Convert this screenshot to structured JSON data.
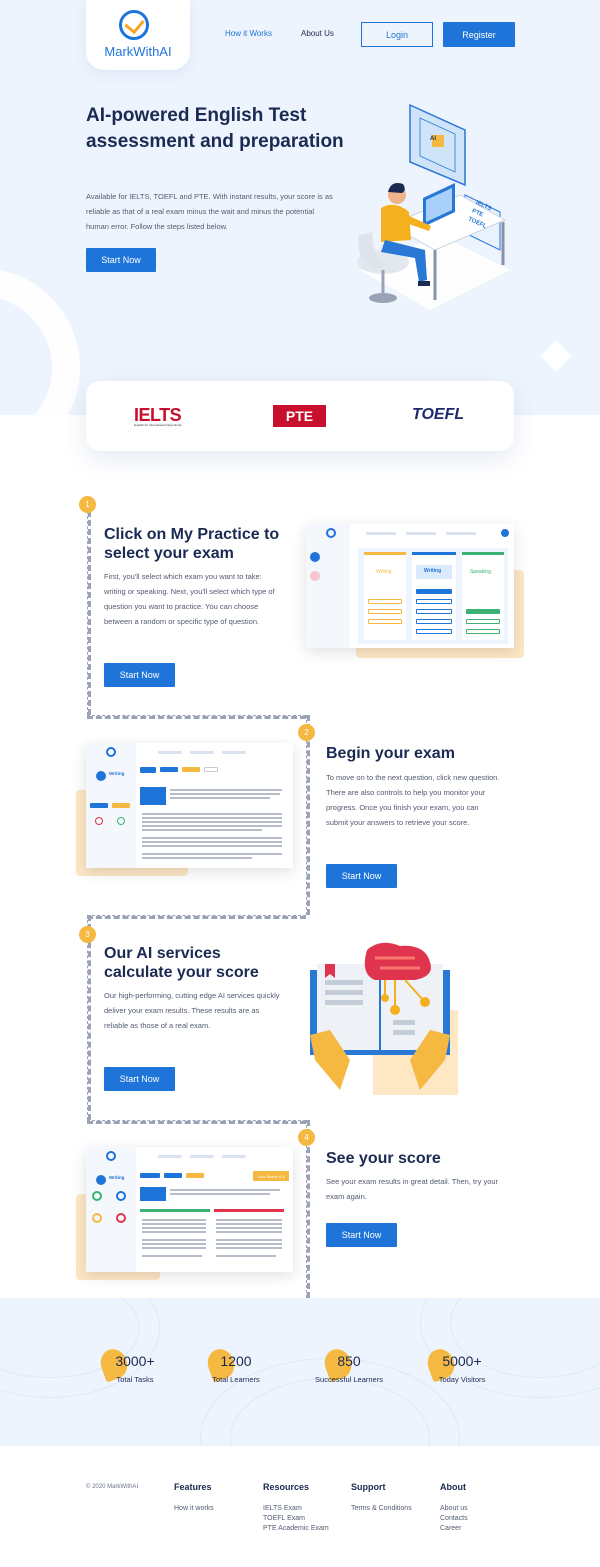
{
  "brand": {
    "name": "MarkWithAI"
  },
  "nav": {
    "how_it_works": "How it Works",
    "about_us": "About Us",
    "login": "Login",
    "register": "Register"
  },
  "hero": {
    "title": "AI-powered English Test assessment and preparation",
    "description": "Available for IELTS, TOEFL and PTE. With instant results, your score is as reliable as that of a real exam minus the wait and minus the potential human error. Follow the steps listed below.",
    "cta": "Start Now",
    "illustration_labels": {
      "ai": "AI",
      "ielts": "IELTS",
      "pte": "PTE",
      "toefl": "TOEFL"
    }
  },
  "partners": {
    "ielts": "IELTS",
    "ielts_sub": "English for International Opportunity",
    "pte": "PTE",
    "toefl": "TOEFL"
  },
  "steps": [
    {
      "number": "1",
      "title": "Click on My Practice to select your exam",
      "description": "First, you'll select which exam you want to take: writing or speaking. Next, you'll select which type of question you want to practice. You can choose between a random or specific type of question.",
      "cta": "Start Now"
    },
    {
      "number": "2",
      "title": "Begin your exam",
      "description": "To move on to the next question, click new question. There are also controls to help you monitor your progress. Once you finish your exam, you can submit your answers to retrieve your score.",
      "cta": "Start Now"
    },
    {
      "number": "3",
      "title": "Our AI services calculate your score",
      "description": "Our high-performing, cutting edge AI services quickly deliver your exam results. These results are as reliable as those of a real exam.",
      "cta": "Start Now"
    },
    {
      "number": "4",
      "title": "See your score",
      "description": "See your exam results in great detail. Then, try your exam again.",
      "cta": "Start Now"
    }
  ],
  "mockups": {
    "step1": {
      "writing": "Writing",
      "speaking": "Speaking"
    },
    "step2": {
      "writing": "Writing"
    },
    "step4": {
      "writing": "Writing",
      "score": "Your Score: 6.5"
    }
  },
  "stats": [
    {
      "value": "3000+",
      "label": "Total Tasks"
    },
    {
      "value": "1200",
      "label": "Total Learners"
    },
    {
      "value": "850",
      "label": "Successful Learners"
    },
    {
      "value": "5000+",
      "label": "Today Visitors"
    }
  ],
  "footer": {
    "copyright": "© 2020 MarkWithAI",
    "columns": [
      {
        "title": "Features",
        "links": [
          "How it works"
        ]
      },
      {
        "title": "Resources",
        "links": [
          "IELTS Exam",
          "TOEFL Exam",
          "PTE Academic Exam"
        ]
      },
      {
        "title": "Support",
        "links": [
          "Terms & Conditions"
        ]
      },
      {
        "title": "About",
        "links": [
          "About us",
          "Contacts",
          "Career"
        ]
      }
    ]
  },
  "colors": {
    "primary": "#1e74d8",
    "accent": "#f5b942",
    "background": "#eef4fd",
    "dark_text": "#1b2a52"
  }
}
